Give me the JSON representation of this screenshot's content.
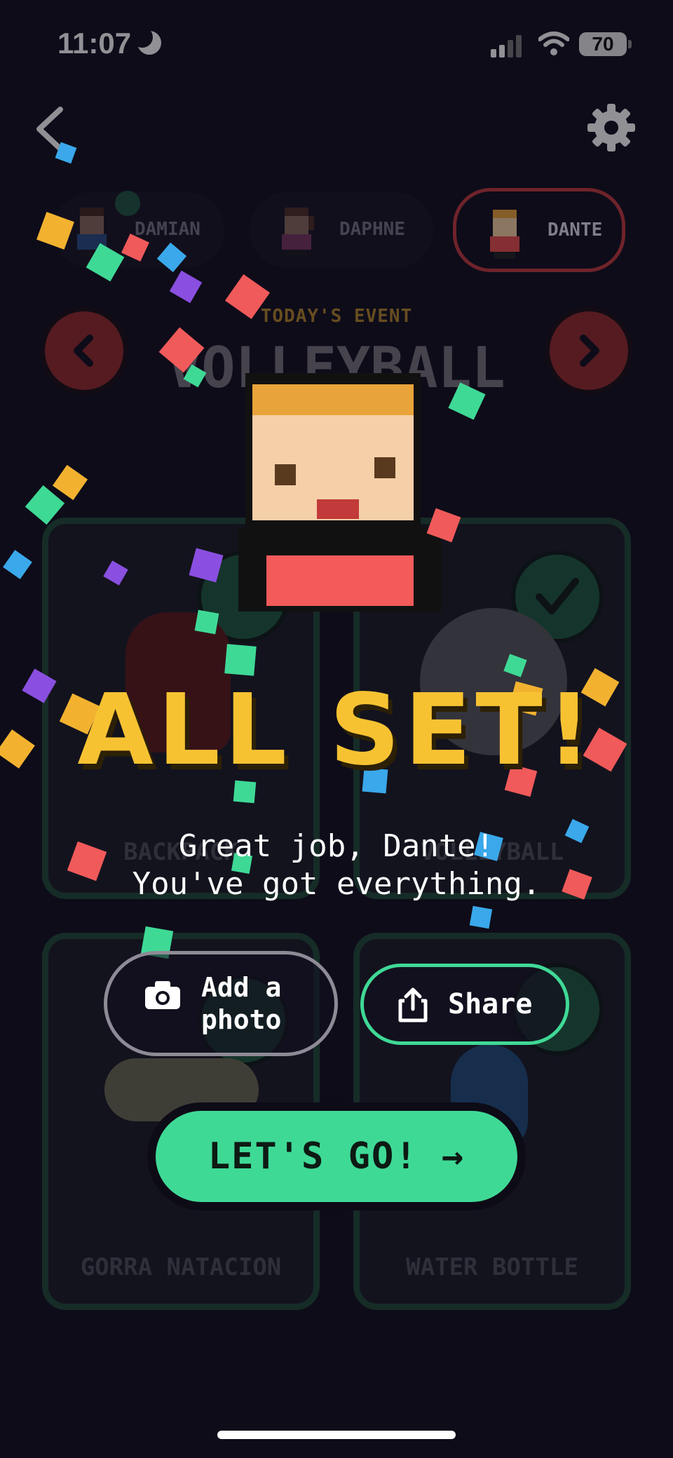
{
  "status_bar": {
    "time": "11:07",
    "battery": "70"
  },
  "kids": [
    {
      "name": "DAMIAN",
      "done": true
    },
    {
      "name": "DAPHNE",
      "done": false
    },
    {
      "name": "DANTE",
      "done": false,
      "active": true
    }
  ],
  "event": {
    "label": "TODAY'S EVENT",
    "name": "VOLLEYBALL"
  },
  "items": [
    {
      "label": "BACKPACK",
      "checked": true
    },
    {
      "label": "VOLLEYBALL",
      "checked": true
    },
    {
      "label": "GORRA NATACION",
      "checked": true
    },
    {
      "label": "WATER BOTTLE",
      "checked": true
    }
  ],
  "celebration": {
    "title": "ALL SET!",
    "message": "Great job, Dante!\nYou've got everything.",
    "photo_label": "Add a\nphoto",
    "share_label": "Share",
    "go_label": "LET'S GO! →"
  },
  "colors": {
    "background": "#120f1e",
    "accent_green": "#3fd996",
    "accent_yellow": "#f7c232",
    "accent_red": "#c2393c"
  },
  "icons": [
    "back-icon",
    "gear-icon",
    "chevron-left-icon",
    "chevron-right-icon",
    "check-icon",
    "camera-icon",
    "share-icon"
  ]
}
